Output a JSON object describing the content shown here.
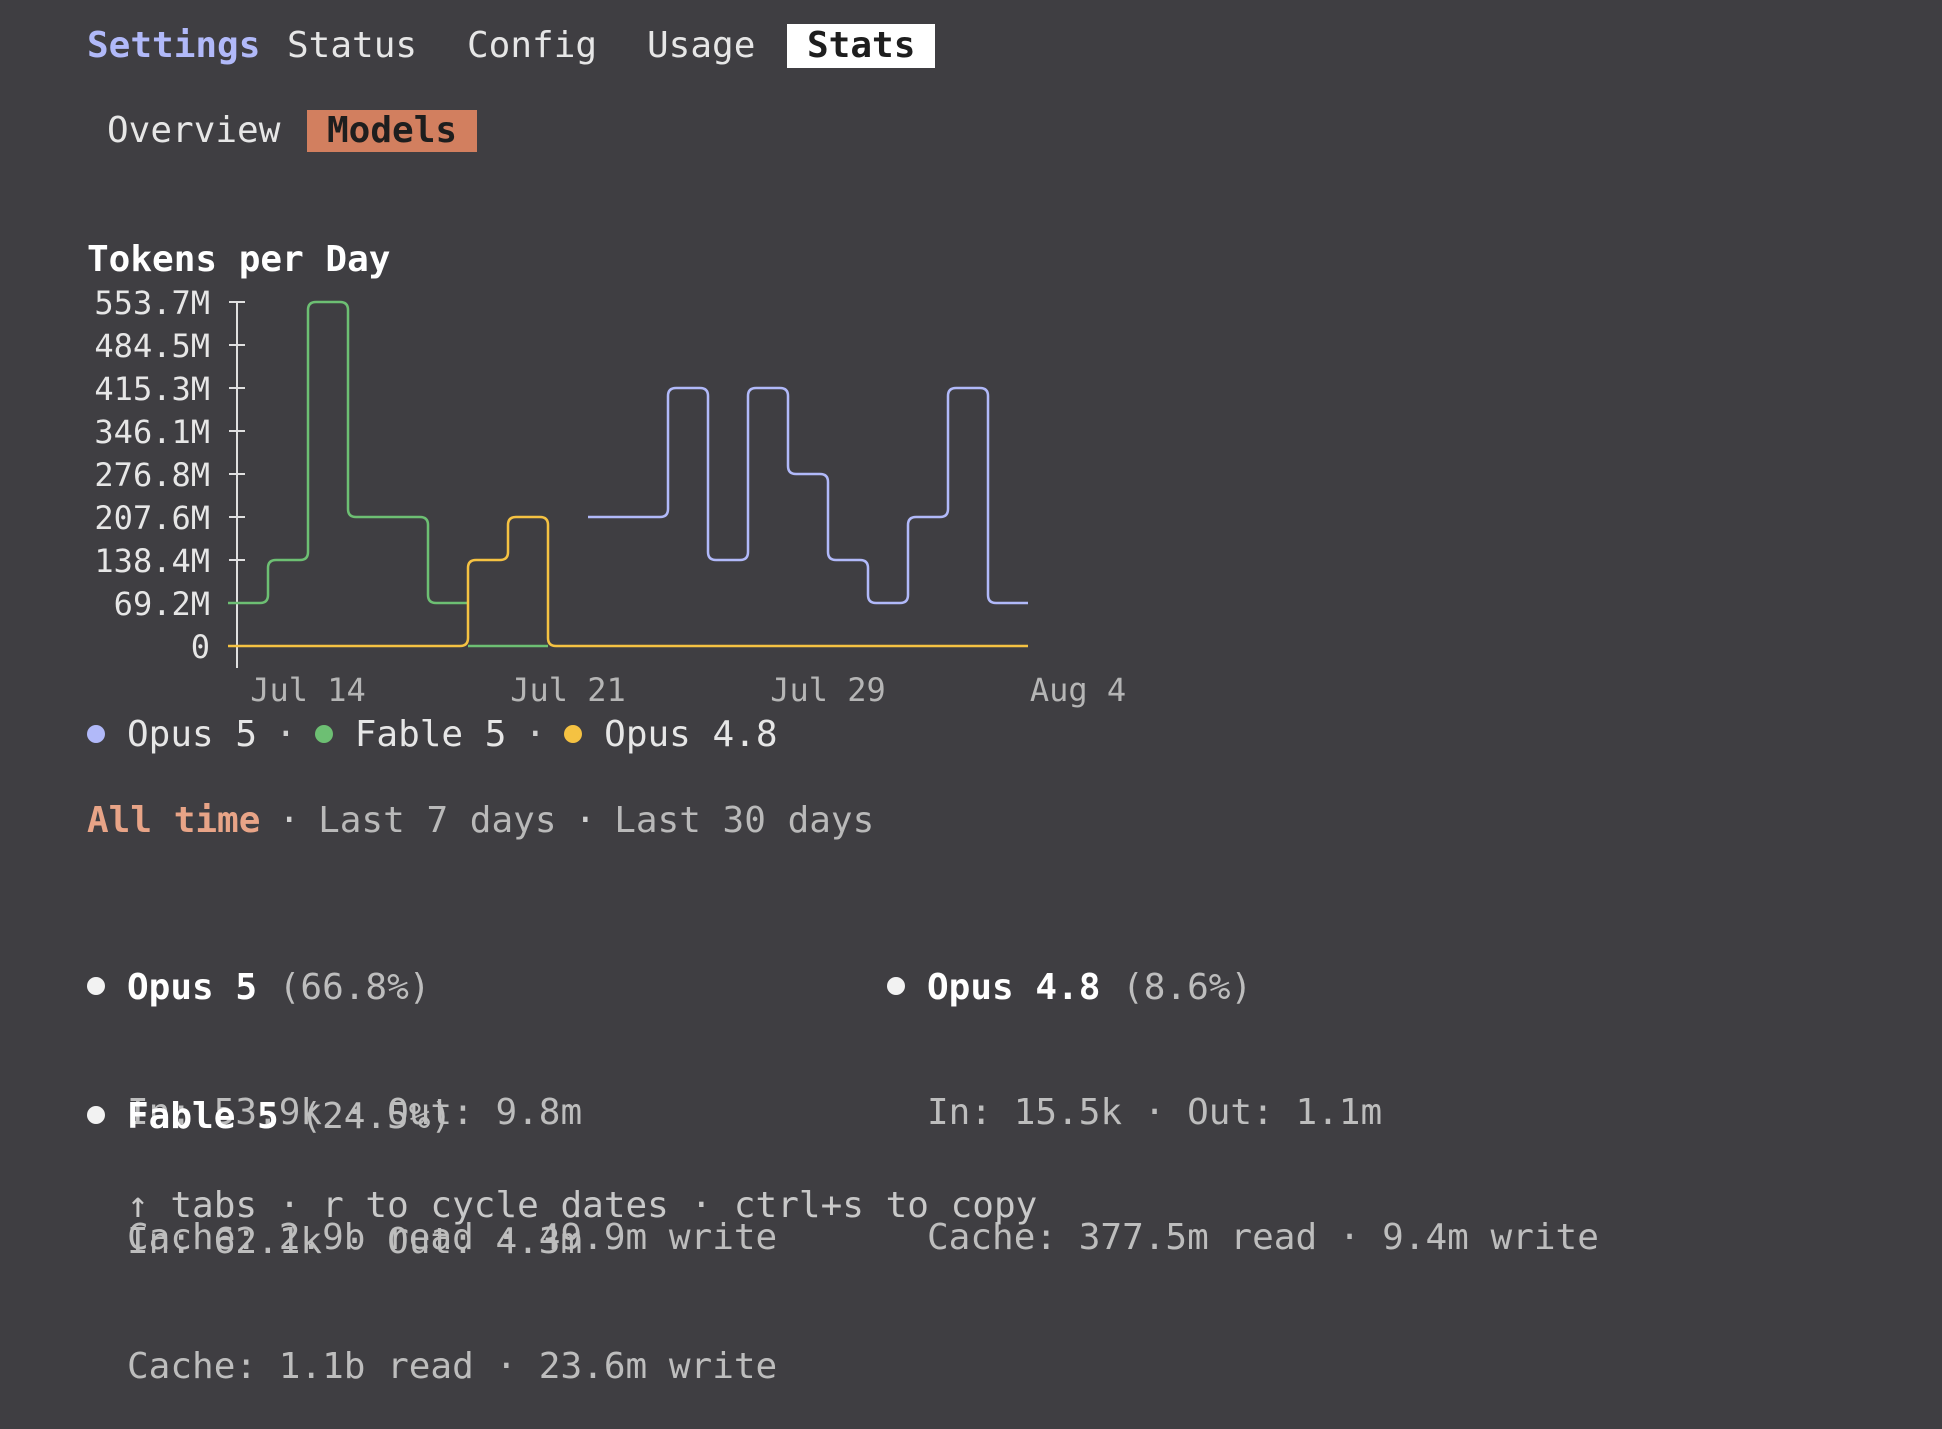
{
  "tabs": {
    "settings": "Settings",
    "items": [
      "Status",
      "Config",
      "Usage"
    ],
    "active": "Stats"
  },
  "subtabs": {
    "overview": "Overview",
    "models": "Models"
  },
  "chart_title": "Tokens per Day",
  "chart_data": {
    "type": "line",
    "title": "Tokens per Day",
    "y_ticks": [
      "553.7M",
      "484.5M",
      "415.3M",
      "346.1M",
      "276.8M",
      "207.6M",
      "138.4M",
      "69.2M",
      "0"
    ],
    "x_ticks": [
      "Jul 14",
      "Jul 21",
      "Jul 29",
      "Aug 4"
    ],
    "ylim": [
      0,
      553.7
    ],
    "y_unit": "M",
    "series": [
      {
        "name": "Opus 5",
        "color": "#b1b9f9",
        "segments": [
          [
            null,
            null,
            null,
            null,
            null,
            null,
            null,
            null,
            null,
            207.6,
            207.6,
            415.3,
            138.4,
            415.3,
            276.8,
            138.4,
            69.2,
            207.6,
            415.3,
            69.2
          ]
        ]
      },
      {
        "name": "Fable 5",
        "color": "#6dbf73",
        "segments": [
          [
            69.2,
            138.4,
            553.7,
            207.6,
            207.6,
            69.2
          ],
          [
            null,
            null,
            null,
            null,
            null,
            null,
            0,
            0
          ]
        ]
      },
      {
        "name": "Opus 4.8",
        "color": "#f5c242",
        "segments": [
          [
            0,
            0,
            0,
            0,
            0,
            0,
            138.4,
            207.6,
            0,
            0,
            0,
            0,
            0,
            0,
            0,
            0,
            0,
            0,
            0,
            0
          ]
        ]
      }
    ]
  },
  "legend": {
    "items": [
      {
        "label": "Opus 5",
        "color": "#b1b9f9"
      },
      {
        "label": "Fable 5",
        "color": "#6dbf73"
      },
      {
        "label": "Opus 4.8",
        "color": "#f5c242"
      }
    ],
    "separator": "·"
  },
  "ranges": {
    "active": "All time",
    "items": [
      "Last 7 days",
      "Last 30 days"
    ],
    "separator": "·"
  },
  "models": [
    {
      "name": "Opus 5",
      "pct": "(66.8%)",
      "io": "In: 53.9k · Out: 9.8m",
      "cache": "Cache: 2.9b read · 49.9m write"
    },
    {
      "name": "Fable 5",
      "pct": "(24.5%)",
      "io": "In: 62.1k · Out: 4.3m",
      "cache": "Cache: 1.1b read · 23.6m write"
    },
    {
      "name": "Opus 4.8",
      "pct": "(8.6%)",
      "io": "In: 15.5k · Out: 1.1m",
      "cache": "Cache: 377.5m read · 9.4m write"
    }
  ],
  "footer": "↑ tabs · r to cycle dates · ctrl+s to copy"
}
